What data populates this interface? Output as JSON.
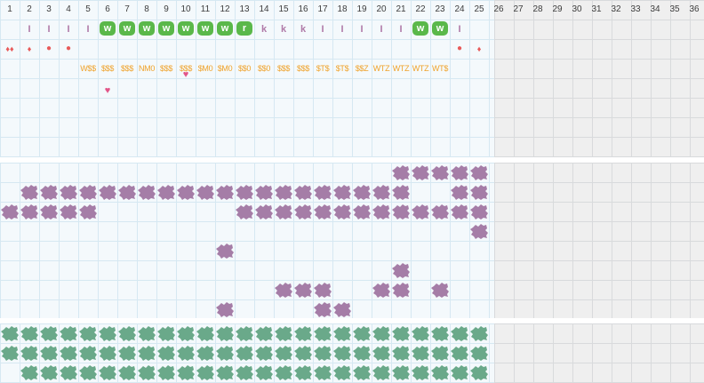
{
  "colors": {
    "grid_line": "#d6e8f2",
    "inactive_grid_line": "#d8dadc",
    "active_bg": "#f4f9fc",
    "inactive_bg": "#efefef",
    "letter_purple": "#b07aa8",
    "badge_green": "#5ab84a",
    "cycle_red": "#e85a5a",
    "heart_pink": "#e25588",
    "code_orange": "#efa22a",
    "blot_purple": "#a57da7",
    "blot_green": "#6aa98a"
  },
  "days": [
    "1",
    "2",
    "3",
    "4",
    "5",
    "6",
    "7",
    "8",
    "9",
    "10",
    "11",
    "12",
    "13",
    "14",
    "15",
    "16",
    "17",
    "18",
    "19",
    "20",
    "21",
    "22",
    "23",
    "24",
    "25",
    "26",
    "27",
    "28",
    "29",
    "30",
    "31",
    "32",
    "33",
    "34",
    "35",
    "36"
  ],
  "active_day_count": 24,
  "letters": [
    {
      "day": 2,
      "text": "I"
    },
    {
      "day": 3,
      "text": "I"
    },
    {
      "day": 4,
      "text": "I"
    },
    {
      "day": 5,
      "text": "I"
    },
    {
      "day": 6,
      "text": "W",
      "badge": true
    },
    {
      "day": 7,
      "text": "W",
      "badge": true
    },
    {
      "day": 8,
      "text": "W",
      "badge": true
    },
    {
      "day": 9,
      "text": "W",
      "badge": true
    },
    {
      "day": 10,
      "text": "W",
      "badge": true
    },
    {
      "day": 11,
      "text": "W",
      "badge": true
    },
    {
      "day": 12,
      "text": "W",
      "badge": true
    },
    {
      "day": 13,
      "text": "r",
      "badge": true
    },
    {
      "day": 14,
      "text": "k"
    },
    {
      "day": 15,
      "text": "k"
    },
    {
      "day": 16,
      "text": "k"
    },
    {
      "day": 17,
      "text": "I"
    },
    {
      "day": 18,
      "text": "I"
    },
    {
      "day": 19,
      "text": "I"
    },
    {
      "day": 20,
      "text": "I"
    },
    {
      "day": 21,
      "text": "I"
    },
    {
      "day": 22,
      "text": "W",
      "badge": true
    },
    {
      "day": 23,
      "text": "W",
      "badge": true
    },
    {
      "day": 24,
      "text": "I"
    }
  ],
  "flow_marks": [
    {
      "day": 1,
      "symbol": "♦♦",
      "kind": "drops"
    },
    {
      "day": 2,
      "symbol": "♦",
      "kind": "drop"
    },
    {
      "day": 3,
      "symbol": "●",
      "kind": "dot"
    },
    {
      "day": 4,
      "symbol": "●",
      "kind": "dot"
    },
    {
      "day": 24,
      "symbol": "●",
      "kind": "dot"
    },
    {
      "day": 25,
      "symbol": "♦",
      "kind": "drop"
    }
  ],
  "codes": [
    {
      "day": 5,
      "text": "W$$"
    },
    {
      "day": 6,
      "text": "$$$"
    },
    {
      "day": 7,
      "text": "$$$"
    },
    {
      "day": 8,
      "text": "NM0"
    },
    {
      "day": 9,
      "text": "$$$"
    },
    {
      "day": 10,
      "text": "$$$"
    },
    {
      "day": 11,
      "text": "$M0"
    },
    {
      "day": 12,
      "text": "$M0"
    },
    {
      "day": 13,
      "text": "$$0"
    },
    {
      "day": 14,
      "text": "$$0"
    },
    {
      "day": 15,
      "text": "$$$"
    },
    {
      "day": 16,
      "text": "$$$"
    },
    {
      "day": 17,
      "text": "$T$"
    },
    {
      "day": 18,
      "text": "$T$"
    },
    {
      "day": 19,
      "text": "$$Z"
    },
    {
      "day": 20,
      "text": "WTZ"
    },
    {
      "day": 21,
      "text": "WTZ"
    },
    {
      "day": 22,
      "text": "WTZ"
    },
    {
      "day": 23,
      "text": "WT$"
    }
  ],
  "hearts": [
    {
      "day": 6,
      "row": 4,
      "symbol": "♥"
    },
    {
      "day": 10,
      "row": 3,
      "symbol": "♥"
    }
  ],
  "purple_rows": [
    [
      21,
      22,
      23,
      24,
      25
    ],
    [
      2,
      3,
      4,
      5,
      6,
      7,
      8,
      9,
      10,
      11,
      12,
      13,
      14,
      15,
      16,
      17,
      18,
      19,
      20,
      21,
      24,
      25
    ],
    [
      1,
      2,
      3,
      4,
      5,
      13,
      14,
      15,
      16,
      17,
      18,
      19,
      20,
      21,
      22,
      23,
      24,
      25
    ],
    [
      25
    ],
    [
      12
    ],
    [
      21
    ],
    [
      15,
      16,
      17,
      20,
      21,
      23
    ],
    [
      12,
      17,
      18
    ]
  ],
  "green_rows": [
    [
      1,
      2,
      3,
      4,
      5,
      6,
      7,
      8,
      9,
      10,
      11,
      12,
      13,
      14,
      15,
      16,
      17,
      18,
      19,
      20,
      21,
      22,
      23,
      24,
      25
    ],
    [
      1,
      2,
      3,
      4,
      5,
      6,
      7,
      8,
      9,
      10,
      11,
      12,
      13,
      14,
      15,
      16,
      17,
      18,
      19,
      20,
      21,
      22,
      23,
      24,
      25
    ],
    [
      2,
      3,
      4,
      5,
      6,
      7,
      8,
      9,
      10,
      11,
      12,
      13,
      14,
      15,
      16,
      17,
      18,
      19,
      20,
      21,
      22,
      23,
      24,
      25
    ]
  ]
}
